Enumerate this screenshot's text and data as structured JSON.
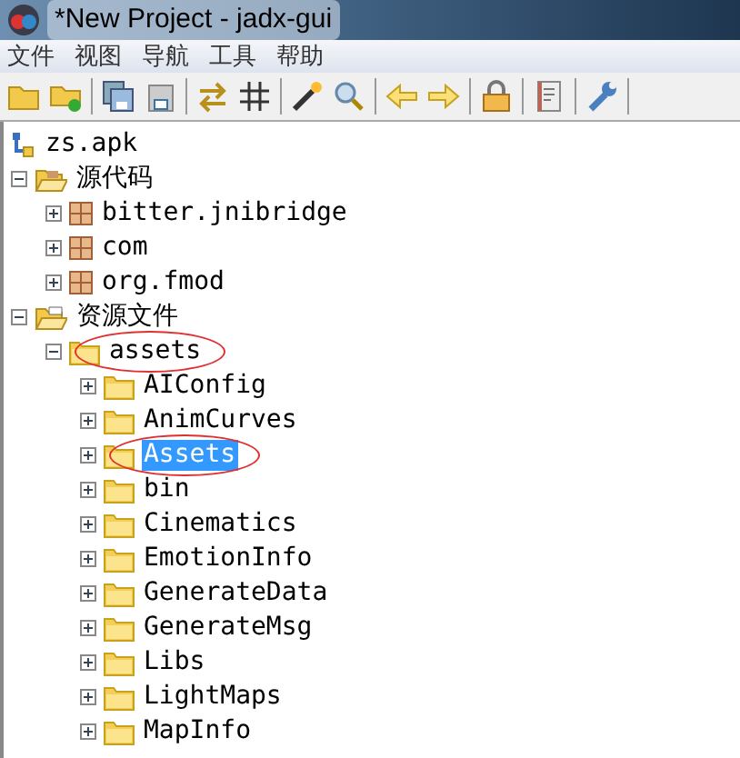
{
  "window": {
    "title": "*New Project - jadx-gui"
  },
  "menu": [
    "文件",
    "视图",
    "导航",
    "工具",
    "帮助"
  ],
  "tree": [
    {
      "label": "zs.apk",
      "kind": "project",
      "selected": false,
      "circled": false,
      "children": [
        {
          "label": "源代码",
          "kind": "source_root",
          "expanded": true,
          "selected": false,
          "circled": false,
          "children": [
            {
              "label": "bitter.jnibridge",
              "kind": "package",
              "expanded": false,
              "selected": false,
              "circled": false
            },
            {
              "label": "com",
              "kind": "package",
              "expanded": false,
              "selected": false,
              "circled": false
            },
            {
              "label": "org.fmod",
              "kind": "package",
              "expanded": false,
              "selected": false,
              "circled": false
            }
          ]
        },
        {
          "label": "资源文件",
          "kind": "resource_root",
          "expanded": true,
          "selected": false,
          "circled": false,
          "children": [
            {
              "label": "assets",
              "kind": "folder",
              "expanded": true,
              "selected": false,
              "circled": true,
              "children": [
                {
                  "label": "AIConfig",
                  "kind": "folder",
                  "expanded": false,
                  "selected": false,
                  "circled": false
                },
                {
                  "label": "AnimCurves",
                  "kind": "folder",
                  "expanded": false,
                  "selected": false,
                  "circled": false
                },
                {
                  "label": "Assets",
                  "kind": "folder",
                  "expanded": false,
                  "selected": true,
                  "circled": true
                },
                {
                  "label": "bin",
                  "kind": "folder",
                  "expanded": false,
                  "selected": false,
                  "circled": false
                },
                {
                  "label": "Cinematics",
                  "kind": "folder",
                  "expanded": false,
                  "selected": false,
                  "circled": false
                },
                {
                  "label": "EmotionInfo",
                  "kind": "folder",
                  "expanded": false,
                  "selected": false,
                  "circled": false
                },
                {
                  "label": "GenerateData",
                  "kind": "folder",
                  "expanded": false,
                  "selected": false,
                  "circled": false
                },
                {
                  "label": "GenerateMsg",
                  "kind": "folder",
                  "expanded": false,
                  "selected": false,
                  "circled": false
                },
                {
                  "label": "Libs",
                  "kind": "folder",
                  "expanded": false,
                  "selected": false,
                  "circled": false
                },
                {
                  "label": "LightMaps",
                  "kind": "folder",
                  "expanded": false,
                  "selected": false,
                  "circled": false
                },
                {
                  "label": "MapInfo",
                  "kind": "folder",
                  "expanded": false,
                  "selected": false,
                  "circled": false
                }
              ]
            }
          ]
        }
      ]
    }
  ]
}
